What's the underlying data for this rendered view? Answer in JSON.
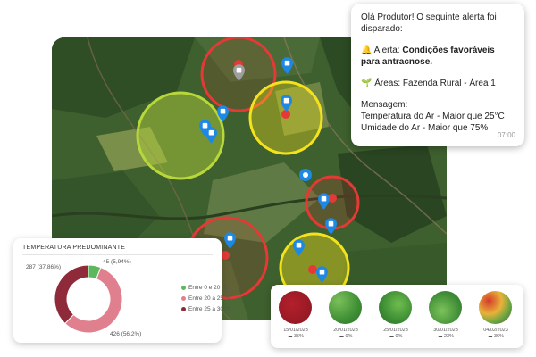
{
  "alert": {
    "line1": "Olá Produtor! O seguinte alerta foi disparado:",
    "alert_prefix": "🔔 Alerta: ",
    "alert_text": "Condições favoráveis para antracnose.",
    "areas": "🌱 Áreas: Fazenda Rural - Área 1",
    "message_title": "Mensagem:",
    "message_line1": "Temperatura do Ar  - Maior que 25°C",
    "message_line2": "Umidade do Ar - Maior que 75%",
    "time": "07:00"
  },
  "temperature_card": {
    "title": "TEMPERATURA PREDOMINANTE"
  },
  "chart_data": {
    "type": "pie",
    "title": "TEMPERATURA PREDOMINANTE",
    "categories": [
      "Entre 0 e 20 °C",
      "Entre 20 a 25 °C",
      "Entre 25 a 30 °C"
    ],
    "values": [
      45,
      426,
      287
    ],
    "percent_labels": [
      "45 (5,94%)",
      "426 (56,2%)",
      "287 (37,86%)"
    ],
    "colors": [
      "#5cb85c",
      "#e0808f",
      "#8f2a3a"
    ],
    "legend": "right"
  },
  "satellite": {
    "items": [
      {
        "date": "15/01/2023",
        "cloud": "35%"
      },
      {
        "date": "20/01/2023",
        "cloud": "0%"
      },
      {
        "date": "25/01/2023",
        "cloud": "0%"
      },
      {
        "date": "30/01/2023",
        "cloud": "23%"
      },
      {
        "date": "04/02/2023",
        "cloud": "36%"
      }
    ]
  },
  "colors": {
    "zone_red": "#e53935",
    "zone_yellow": "#f4e21a",
    "zone_green": "#b7d73b",
    "pin_blue": "#1e88e5"
  }
}
